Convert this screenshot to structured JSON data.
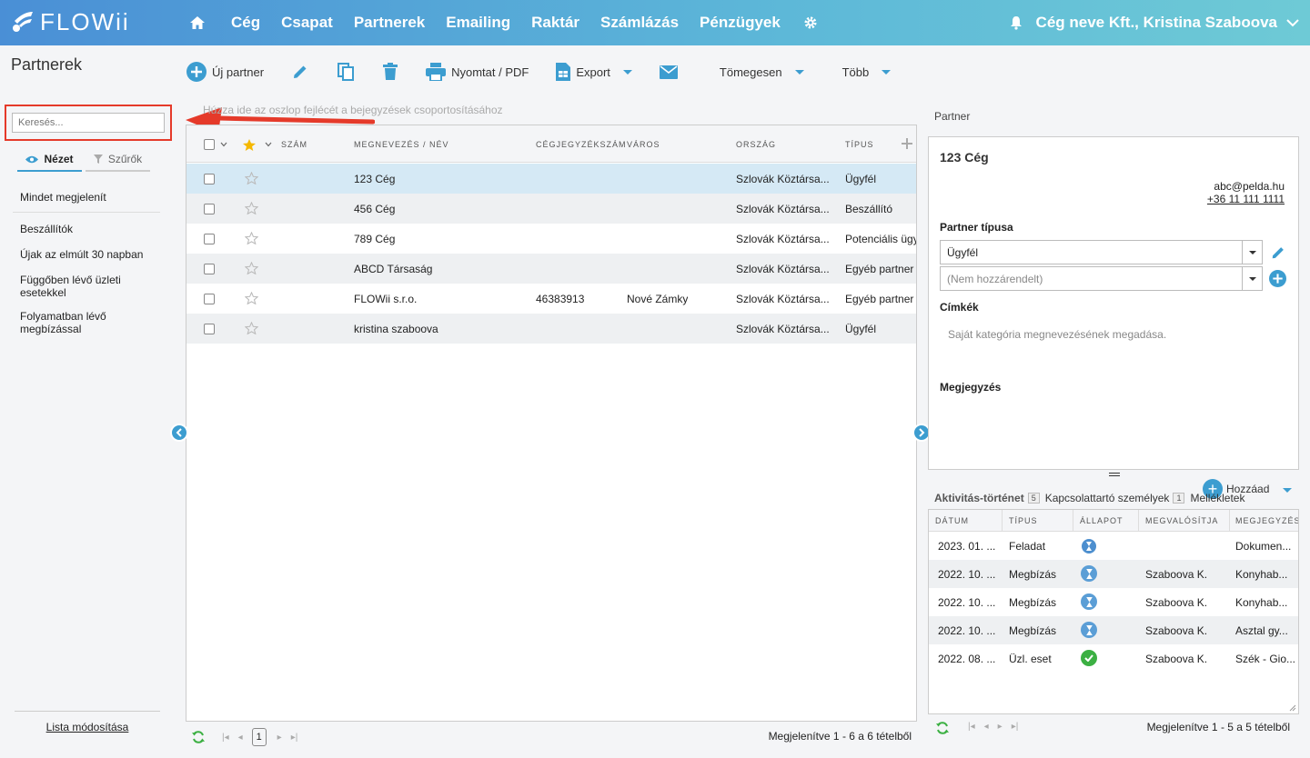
{
  "app": {
    "logo_text": "FLOWii"
  },
  "nav": {
    "items": [
      "Cég",
      "Csapat",
      "Partnerek",
      "Emailing",
      "Raktár",
      "Számlázás",
      "Pénzügyek"
    ]
  },
  "user": {
    "label": "Cég neve Kft., Kristina Szaboova"
  },
  "page": {
    "title": "Partnerek"
  },
  "toolbar": {
    "new_partner": "Új partner",
    "print": "Nyomtat / PDF",
    "export": "Export",
    "bulk": "Tömegesen",
    "more": "Több"
  },
  "left": {
    "search_placeholder": "Keresés...",
    "tab_view": "Nézet",
    "tab_filters": "Szűrők",
    "items": [
      "Mindet megjelenít",
      "Beszállítók",
      "Újak az elmúlt 30 napban",
      "Függőben lévő üzleti esetekkel",
      "Folyamatban lévő megbízással"
    ],
    "footer_link": "Lista módosítása"
  },
  "grid": {
    "groupby_hint": "Húzza ide az oszlop fejlécét a bejegyzések csoportosításához",
    "headers": {
      "number": "SZÁM",
      "name": "MEGNEVEZÉS / NÉV",
      "reg": "CÉGJEGYZÉKSZÁM",
      "city": "VÁROS",
      "country": "ORSZÁG",
      "type": "TÍPUS"
    },
    "rows": [
      {
        "name": "123 Cég",
        "reg": "",
        "city": "",
        "country": "Szlovák Köztársa...",
        "type": "Ügyfél"
      },
      {
        "name": "456 Cég",
        "reg": "",
        "city": "",
        "country": "Szlovák Köztársa...",
        "type": "Beszállító"
      },
      {
        "name": "789 Cég",
        "reg": "",
        "city": "",
        "country": "Szlovák Köztársa...",
        "type": "Potenciális ügy"
      },
      {
        "name": "ABCD Társaság",
        "reg": "",
        "city": "",
        "country": "Szlovák Köztársa...",
        "type": "Egyéb partner"
      },
      {
        "name": "FLOWii s.r.o.",
        "reg": "46383913",
        "city": "Nové Zámky",
        "country": "Szlovák Köztársa...",
        "type": "Egyéb partner"
      },
      {
        "name": "kristina szaboova",
        "reg": "",
        "city": "",
        "country": "Szlovák Köztársa...",
        "type": "Ügyfél"
      }
    ],
    "page": "1",
    "count": "Megjelenítve 1 - 6 a 6 tételből"
  },
  "partner": {
    "section_title": "Partner",
    "name": "123 Cég",
    "email": "abc@pelda.hu",
    "phone": "+36 11 111 1111",
    "type_label": "Partner típusa",
    "type_value": "Ügyfél",
    "unassigned": "(Nem hozzárendelt)",
    "tags_label": "Címkék",
    "tags_placeholder": "Saját kategória megnevezésének megadása.",
    "note_label": "Megjegyzés"
  },
  "activity": {
    "add_label": "Hozzáad",
    "tabs": [
      {
        "label": "Aktivitás-történet",
        "count": "5"
      },
      {
        "label": "Kapcsolattartó személyek",
        "count": "1"
      },
      {
        "label": "Mellékletek",
        "count": ""
      }
    ],
    "headers": {
      "date": "DÁTUM",
      "type": "TÍPUS",
      "status": "ÁLLAPOT",
      "owner": "MEGVALÓSÍTJA",
      "note": "MEGJEGYZÉS"
    },
    "rows": [
      {
        "date": "2023. 01. ...",
        "type": "Feladat",
        "status": "pending",
        "owner": "",
        "note": "Dokumen..."
      },
      {
        "date": "2022. 10. ...",
        "type": "Megbízás",
        "status": "pending",
        "owner": "Szaboova K.",
        "note": "Konyhab..."
      },
      {
        "date": "2022. 10. ...",
        "type": "Megbízás",
        "status": "pending",
        "owner": "Szaboova K.",
        "note": "Konyhab..."
      },
      {
        "date": "2022. 10. ...",
        "type": "Megbízás",
        "status": "pending",
        "owner": "Szaboova K.",
        "note": "Asztal gy..."
      },
      {
        "date": "2022. 08. ...",
        "type": "Üzl. eset",
        "status": "done",
        "owner": "Szaboova K.",
        "note": "Szék - Gio..."
      }
    ],
    "count": "Megjelenítve 1 - 5 a 5 tételből"
  },
  "colors": {
    "accent": "#3c9dd0",
    "highlight": "#e53a2a",
    "selected_row": "#d5e9f5",
    "success": "#3cb043"
  }
}
